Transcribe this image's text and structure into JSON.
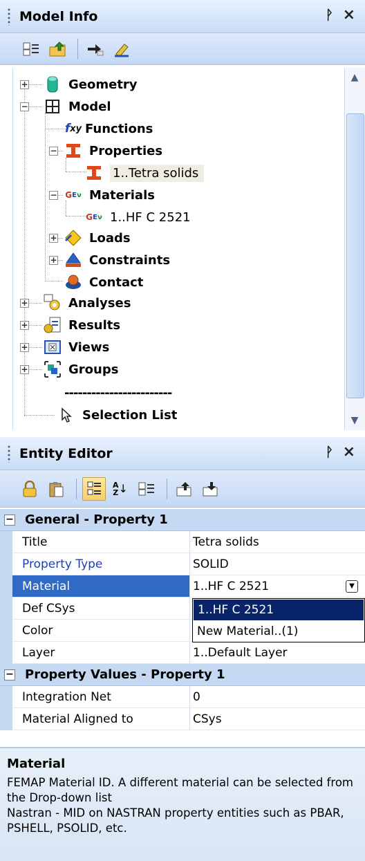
{
  "model_info": {
    "title": "Model Info",
    "pin": "ᚹ",
    "close": "×",
    "tree": {
      "geometry": "Geometry",
      "model": "Model",
      "functions": "Functions",
      "properties": "Properties",
      "property_item": "1..Tetra solids",
      "materials": "Materials",
      "material_item": "1..HF C 2521",
      "loads": "Loads",
      "constraints": "Constraints",
      "contact": "Contact",
      "analyses": "Analyses",
      "results": "Results",
      "views": "Views",
      "groups": "Groups",
      "separator": "------------------------",
      "selection_list": "Selection List"
    }
  },
  "entity_editor": {
    "title": "Entity Editor",
    "pin": "ᚹ",
    "close": "×",
    "general": {
      "label": "General - Property 1",
      "rows": [
        {
          "name": "Title",
          "value": "Tetra solids"
        },
        {
          "name": "Property Type",
          "value": "SOLID"
        },
        {
          "name": "Material",
          "value": "1..HF C 2521"
        },
        {
          "name": "Def CSys",
          "value": ""
        },
        {
          "name": "Color",
          "value": ""
        },
        {
          "name": "Layer",
          "value": "1..Default Layer"
        }
      ]
    },
    "values": {
      "label": "Property Values - Property 1",
      "rows": [
        {
          "name": "Integration Net",
          "value": "0"
        },
        {
          "name": "Material Aligned to",
          "value": "CSys"
        }
      ]
    },
    "dropdown_options": [
      "1..HF C 2521",
      "New Material..(1)"
    ],
    "help": {
      "title": "Material",
      "text": "FEMAP Material ID.  A different material can be selected from the Drop-down list\nNastran - MID on NASTRAN property entities such as PBAR, PSHELL, PSOLID, etc."
    }
  },
  "colors": {
    "header_bg": "#c9dcf6",
    "category_bg": "#c6d9f3",
    "selected_row": "#3169c6",
    "dropdown_selected": "#0a246a",
    "link_blue": "#1b3fb4"
  }
}
